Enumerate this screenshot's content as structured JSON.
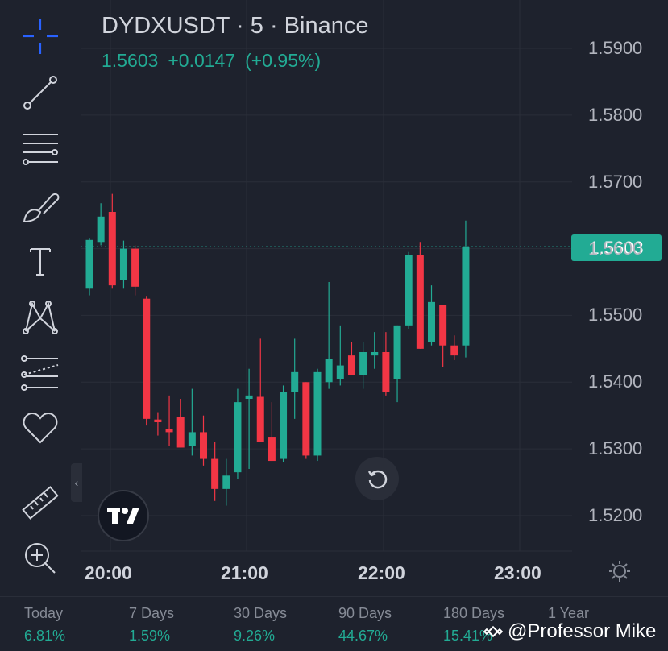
{
  "header": {
    "symbol": "DYDXUSDT · 5 · Binance",
    "last": "1.5603",
    "change": "+0.0147",
    "change_pct": "(+0.95%)"
  },
  "price_tag": "1.5603",
  "colors": {
    "up": "#22ab94",
    "down": "#f23645",
    "bg": "#1e222d",
    "grid": "#2a2e39"
  },
  "toolbar": [
    "crosshair-icon",
    "trend-line-icon",
    "fib-retracement-icon",
    "brush-icon",
    "text-icon",
    "pattern-icon",
    "forecast-icon",
    "heart-icon",
    "ruler-icon",
    "zoom-in-icon"
  ],
  "chart_data": {
    "type": "candlestick",
    "interval": "5",
    "y_ticks": [
      "1.5900",
      "1.5800",
      "1.5700",
      "1.5600",
      "1.5500",
      "1.5400",
      "1.5300",
      "1.5200"
    ],
    "ylim": [
      1.5145,
      1.5965
    ],
    "x_ticks": [
      "20:00",
      "21:00",
      "22:00",
      "23:00"
    ],
    "last_price": 1.5603,
    "candles": [
      {
        "o": 1.554,
        "h": 1.5615,
        "l": 1.553,
        "c": 1.5613
      },
      {
        "o": 1.561,
        "h": 1.5668,
        "l": 1.5605,
        "c": 1.5648
      },
      {
        "o": 1.5655,
        "h": 1.5682,
        "l": 1.554,
        "c": 1.5545
      },
      {
        "o": 1.5553,
        "h": 1.5612,
        "l": 1.554,
        "c": 1.56
      },
      {
        "o": 1.56,
        "h": 1.5605,
        "l": 1.553,
        "c": 1.5543
      },
      {
        "o": 1.5525,
        "h": 1.5528,
        "l": 1.5335,
        "c": 1.5345
      },
      {
        "o": 1.5344,
        "h": 1.5355,
        "l": 1.532,
        "c": 1.534
      },
      {
        "o": 1.533,
        "h": 1.538,
        "l": 1.5305,
        "c": 1.5325
      },
      {
        "o": 1.5348,
        "h": 1.5375,
        "l": 1.5302,
        "c": 1.5302
      },
      {
        "o": 1.5305,
        "h": 1.539,
        "l": 1.529,
        "c": 1.5325
      },
      {
        "o": 1.5325,
        "h": 1.535,
        "l": 1.5275,
        "c": 1.5285
      },
      {
        "o": 1.5285,
        "h": 1.531,
        "l": 1.5222,
        "c": 1.524
      },
      {
        "o": 1.524,
        "h": 1.5285,
        "l": 1.5215,
        "c": 1.526
      },
      {
        "o": 1.5265,
        "h": 1.539,
        "l": 1.5255,
        "c": 1.537
      },
      {
        "o": 1.5375,
        "h": 1.542,
        "l": 1.527,
        "c": 1.538
      },
      {
        "o": 1.5378,
        "h": 1.5465,
        "l": 1.531,
        "c": 1.531
      },
      {
        "o": 1.5317,
        "h": 1.537,
        "l": 1.5282,
        "c": 1.5282
      },
      {
        "o": 1.5285,
        "h": 1.5395,
        "l": 1.528,
        "c": 1.5385
      },
      {
        "o": 1.5385,
        "h": 1.5465,
        "l": 1.5345,
        "c": 1.5415
      },
      {
        "o": 1.54,
        "h": 1.54,
        "l": 1.5285,
        "c": 1.529
      },
      {
        "o": 1.529,
        "h": 1.542,
        "l": 1.5282,
        "c": 1.5415
      },
      {
        "o": 1.54,
        "h": 1.555,
        "l": 1.539,
        "c": 1.5435
      },
      {
        "o": 1.5405,
        "h": 1.5485,
        "l": 1.5395,
        "c": 1.5425
      },
      {
        "o": 1.544,
        "h": 1.546,
        "l": 1.542,
        "c": 1.541
      },
      {
        "o": 1.541,
        "h": 1.546,
        "l": 1.539,
        "c": 1.5445
      },
      {
        "o": 1.544,
        "h": 1.5475,
        "l": 1.542,
        "c": 1.5445
      },
      {
        "o": 1.5445,
        "h": 1.5475,
        "l": 1.538,
        "c": 1.5385
      },
      {
        "o": 1.5405,
        "h": 1.5485,
        "l": 1.537,
        "c": 1.5485
      },
      {
        "o": 1.5485,
        "h": 1.5595,
        "l": 1.548,
        "c": 1.559
      },
      {
        "o": 1.559,
        "h": 1.561,
        "l": 1.545,
        "c": 1.545
      },
      {
        "o": 1.546,
        "h": 1.5545,
        "l": 1.5455,
        "c": 1.552
      },
      {
        "o": 1.5515,
        "h": 1.5515,
        "l": 1.5423,
        "c": 1.5455
      },
      {
        "o": 1.5455,
        "h": 1.547,
        "l": 1.5433,
        "c": 1.544
      },
      {
        "o": 1.5455,
        "h": 1.5642,
        "l": 1.5437,
        "c": 1.5603
      }
    ]
  },
  "performance": [
    {
      "label": "Today",
      "value": "6.81%"
    },
    {
      "label": "7 Days",
      "value": "1.59%"
    },
    {
      "label": "30 Days",
      "value": "9.26%"
    },
    {
      "label": "90 Days",
      "value": "44.67%"
    },
    {
      "label": "180 Days",
      "value": "15.41%"
    },
    {
      "label": "1 Year",
      "value": ""
    }
  ],
  "watermark": "@Professor Mike"
}
